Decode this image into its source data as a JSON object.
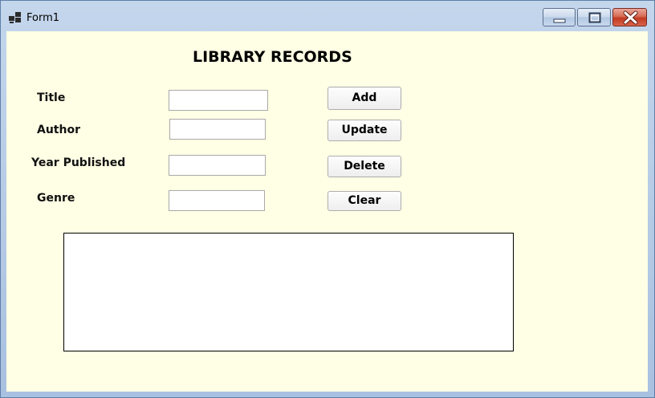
{
  "window": {
    "title": "Form1",
    "app_icon": "winforms-app-icon",
    "controls": {
      "minimize_icon": "minimize-icon",
      "maximize_icon": "maximize-icon",
      "close_icon": "close-icon"
    },
    "colors": {
      "client_background": "#ffffe5",
      "close_button": "#c23a22"
    }
  },
  "form": {
    "heading": "LIBRARY RECORDS",
    "fields": [
      {
        "label": "Title",
        "value": ""
      },
      {
        "label": "Author",
        "value": ""
      },
      {
        "label": "Year Published",
        "value": ""
      },
      {
        "label": "Genre",
        "value": ""
      }
    ],
    "buttons": {
      "add": "Add",
      "update": "Update",
      "delete": "Delete",
      "clear": "Clear"
    },
    "records_list": []
  }
}
